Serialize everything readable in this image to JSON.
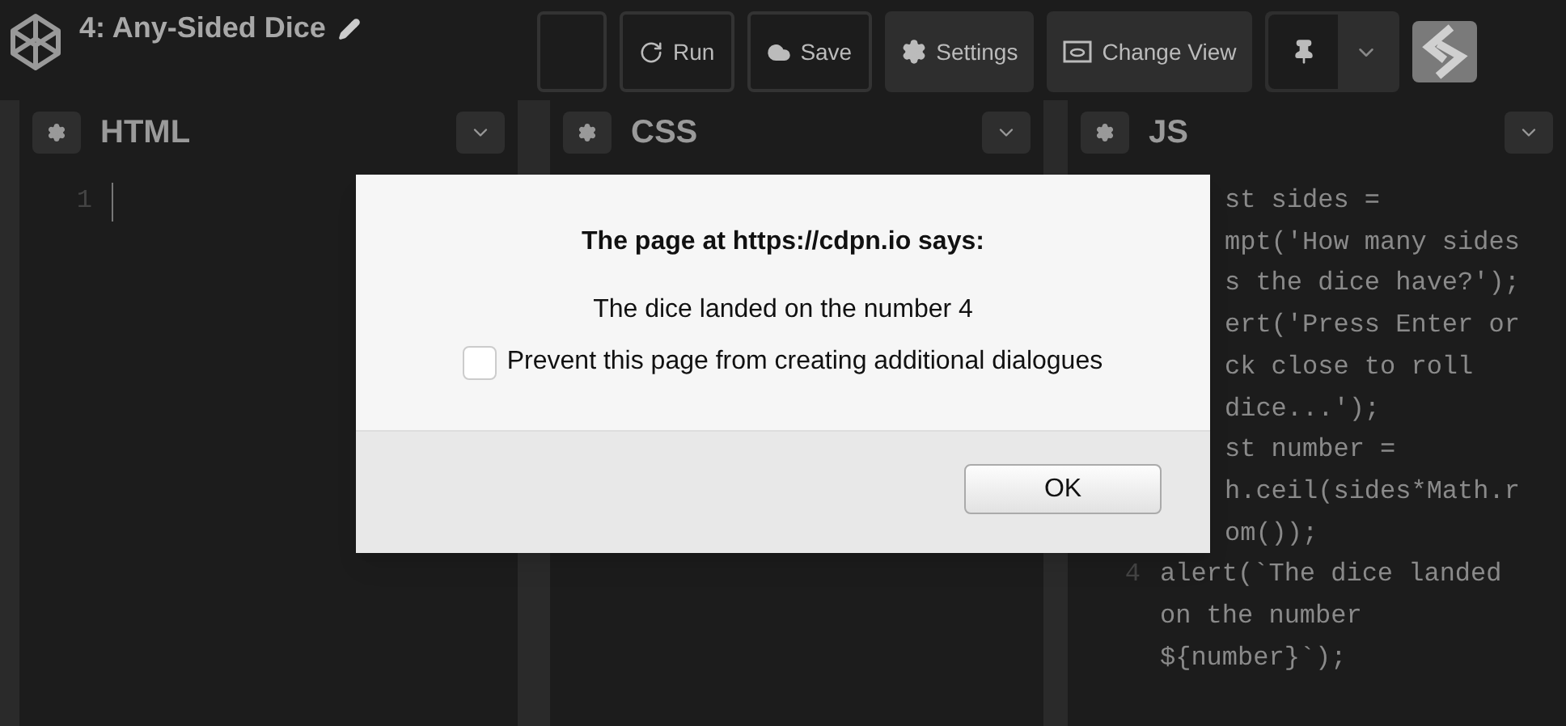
{
  "header": {
    "title": "4: Any-Sided Dice",
    "buttons": [
      {
        "kind": "run",
        "label": "Run"
      },
      {
        "kind": "save",
        "label": "Save"
      },
      {
        "kind": "settings",
        "label": "Settings"
      },
      {
        "kind": "view",
        "label": "Change View"
      }
    ]
  },
  "editors": [
    {
      "title": "HTML",
      "lines": [
        {
          "kind": "full",
          "number": "1",
          "cursor": true
        }
      ]
    },
    {
      "title": "CSS"
    },
    {
      "title": "JS",
      "lines": [
        {
          "kind": "partial",
          "text": "st sides ="
        },
        {
          "kind": "partial",
          "text": "mpt('How many sides"
        },
        {
          "kind": "partial",
          "text": "s the dice have?');"
        },
        {
          "kind": "partial",
          "text": "ert('Press Enter or"
        },
        {
          "kind": "partial",
          "text": "ck close to roll"
        },
        {
          "kind": "partial",
          "text": "dice...');"
        },
        {
          "kind": "partial",
          "text": "st number ="
        },
        {
          "kind": "partial",
          "text": "h.ceil(sides*Math.r"
        },
        {
          "kind": "partial",
          "text": "om());"
        },
        {
          "kind": "full",
          "number": "4",
          "text": "alert(`The dice landed"
        },
        {
          "kind": "full",
          "text": "on the number"
        },
        {
          "kind": "full",
          "text": "${number}`);"
        }
      ]
    }
  ],
  "dialog": {
    "title": "The page at https://cdpn.io says:",
    "message": "The dice landed on the number 4",
    "checkbox": {
      "label": "Prevent this page from creating additional dialogues",
      "checked": false
    },
    "button": "OK"
  }
}
